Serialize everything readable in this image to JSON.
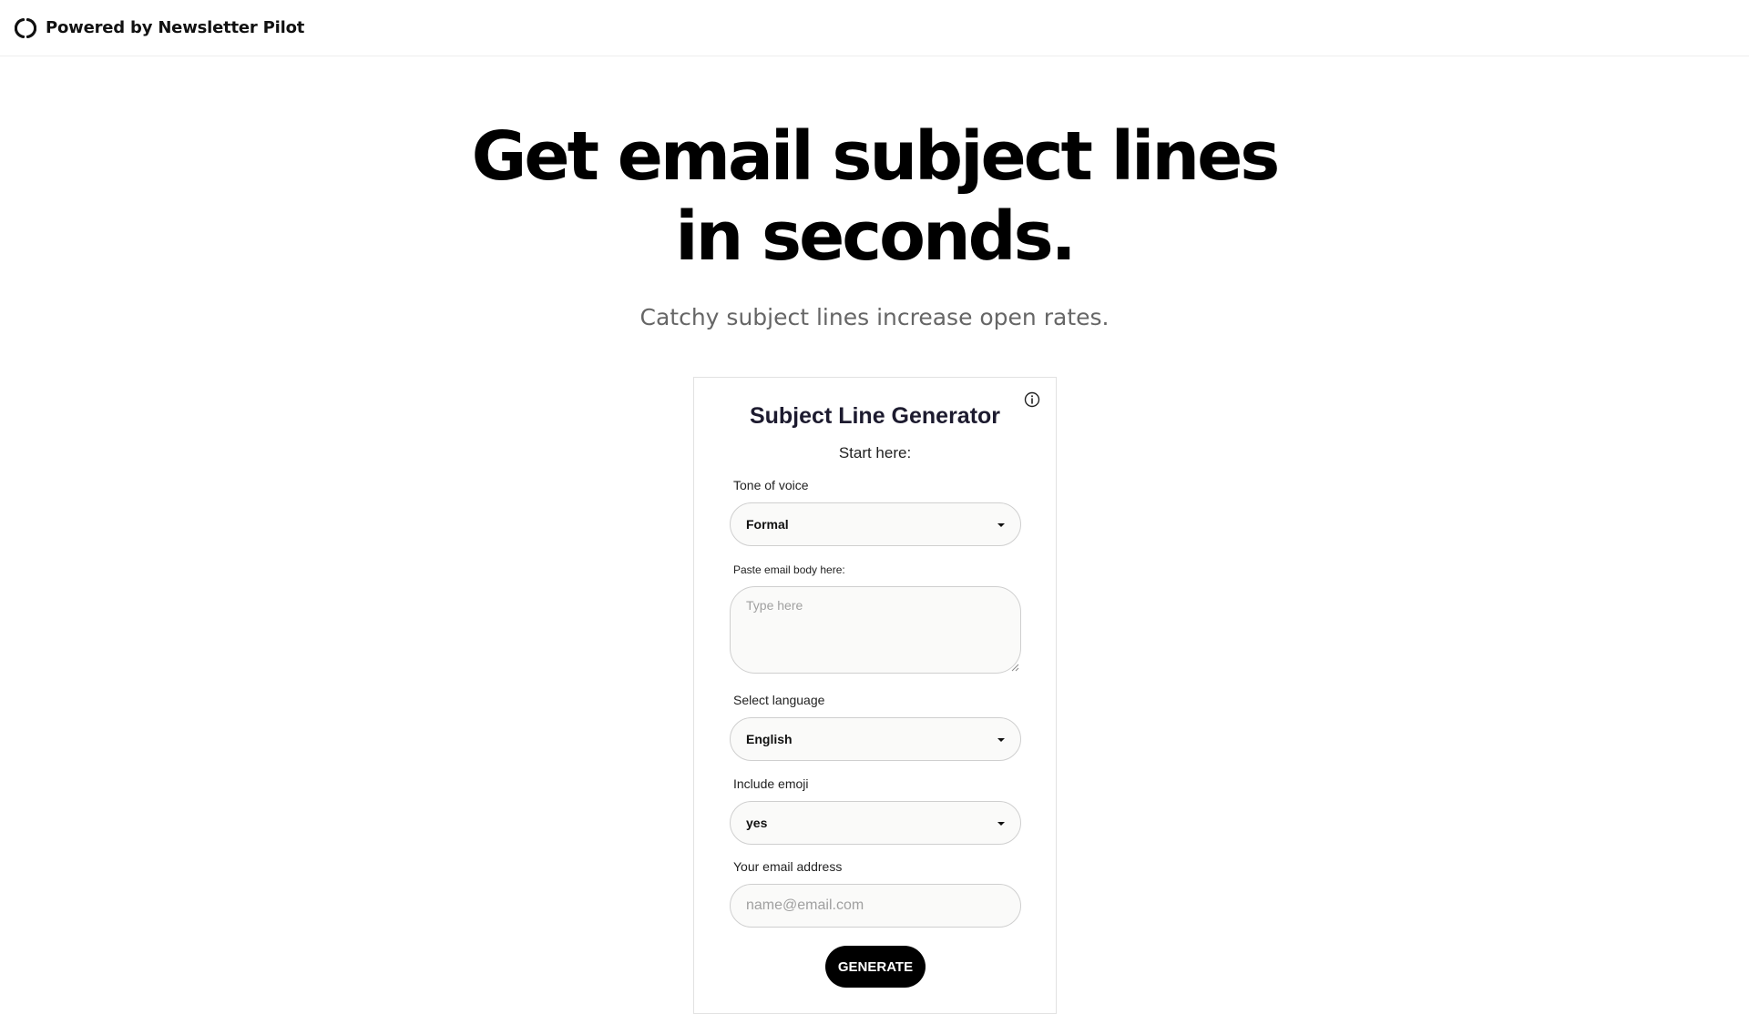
{
  "header": {
    "brand_text": "Powered by Newsletter Pilot",
    "logo_icon": "newsletter-pilot-logo-icon"
  },
  "hero": {
    "title_line1": "Get email subject lines",
    "title_line2": "in seconds.",
    "subtitle": "Catchy subject lines increase open rates."
  },
  "form": {
    "title": "Subject Line Generator",
    "start_text": "Start here:",
    "info_icon": "info-icon",
    "tone": {
      "label": "Tone of voice",
      "value": "Formal"
    },
    "body": {
      "label": "Paste email body here:",
      "placeholder": "Type here",
      "value": ""
    },
    "language": {
      "label": "Select language",
      "value": "English"
    },
    "emoji": {
      "label": "Include emoji",
      "value": "yes"
    },
    "email": {
      "label": "Your email address",
      "placeholder": "name@email.com",
      "value": ""
    },
    "generate_label": "GENERATE"
  },
  "colors": {
    "button_bg": "#000000",
    "title_color": "#1d1b2f",
    "subtitle_color": "#666666"
  }
}
